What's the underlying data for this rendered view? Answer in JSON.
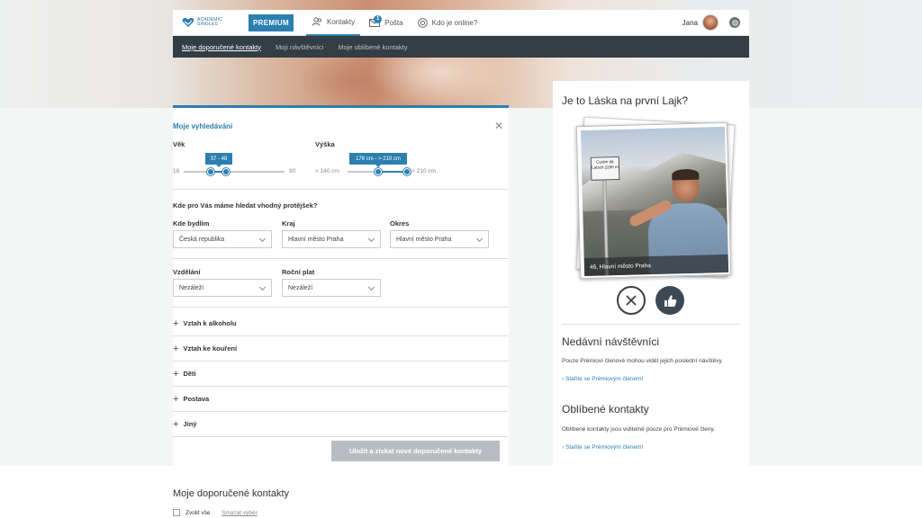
{
  "header": {
    "logo_line1": "ACADEMIC",
    "logo_line2": "SINGLES",
    "premium_label": "PREMIUM",
    "nav": [
      {
        "label": "Kontakty"
      },
      {
        "label": "Pošta",
        "badge": "1"
      },
      {
        "label": "Kdo je online?"
      }
    ],
    "user_name": "Jana"
  },
  "subnav": {
    "items": [
      {
        "label": "Moje doporučené kontakty"
      },
      {
        "label": "Moji návštěvníci"
      },
      {
        "label": "Moje oblíbené kontakty"
      }
    ]
  },
  "search": {
    "title": "Moje vyhledávání",
    "age": {
      "label": "Věk",
      "min": "18",
      "max": "90",
      "tooltip": "37 - 48",
      "range_values": [
        37,
        48
      ],
      "limits": [
        18,
        90
      ]
    },
    "height": {
      "label": "Výška",
      "min": "< 140 cm",
      "max": "> 210 cm",
      "tooltip": "176 cm - > 210 cm",
      "range_values": [
        176,
        210
      ],
      "limits": [
        140,
        210
      ]
    },
    "location_question": "Kde pro Vás máme hledat vhodný protějšek?",
    "fields": {
      "residence": {
        "label": "Kde bydlím",
        "value": "Česká republika"
      },
      "region": {
        "label": "Kraj",
        "value": "Hlavní město Praha"
      },
      "district": {
        "label": "Okres",
        "value": "Hlavní město Praha"
      },
      "education": {
        "label": "Vzdělání",
        "value": "Nezáleží"
      },
      "income": {
        "label": "Roční plat",
        "value": "Nezáleží"
      }
    },
    "accordions": [
      "Vztah k alkoholu",
      "Vztah ke kouření",
      "Děti",
      "Postava",
      "Jiný"
    ],
    "save_label": "Uložit a získat nové doporučené kontakty"
  },
  "right": {
    "title": "Je to Láska na první Lajk?",
    "sign_text": "Cuolm da Latsch 2296 m",
    "photo_caption": "46, Hlavní město Praha",
    "recent": {
      "title": "Nedávní návštěvníci",
      "text": "Pouze Prémioví členové mohou vidět jejich poslední návštěvy",
      "link": "Staňte se Prémiovým členem!"
    },
    "favorites": {
      "title": "Oblíbené kontakty",
      "text": "Oblíbené kontakty jsou viditelné pouze pro Prémiové členy.",
      "link": "Staňte se Prémiovým členem!"
    }
  },
  "bottom": {
    "title": "Moje doporučené kontakty",
    "select_all": "Zvolit vše",
    "clear": "Smazat výběr"
  },
  "colors": {
    "accent": "#2c7fb0",
    "subnav_bg": "#333d46",
    "button_disabled": "#b9bdc1"
  }
}
